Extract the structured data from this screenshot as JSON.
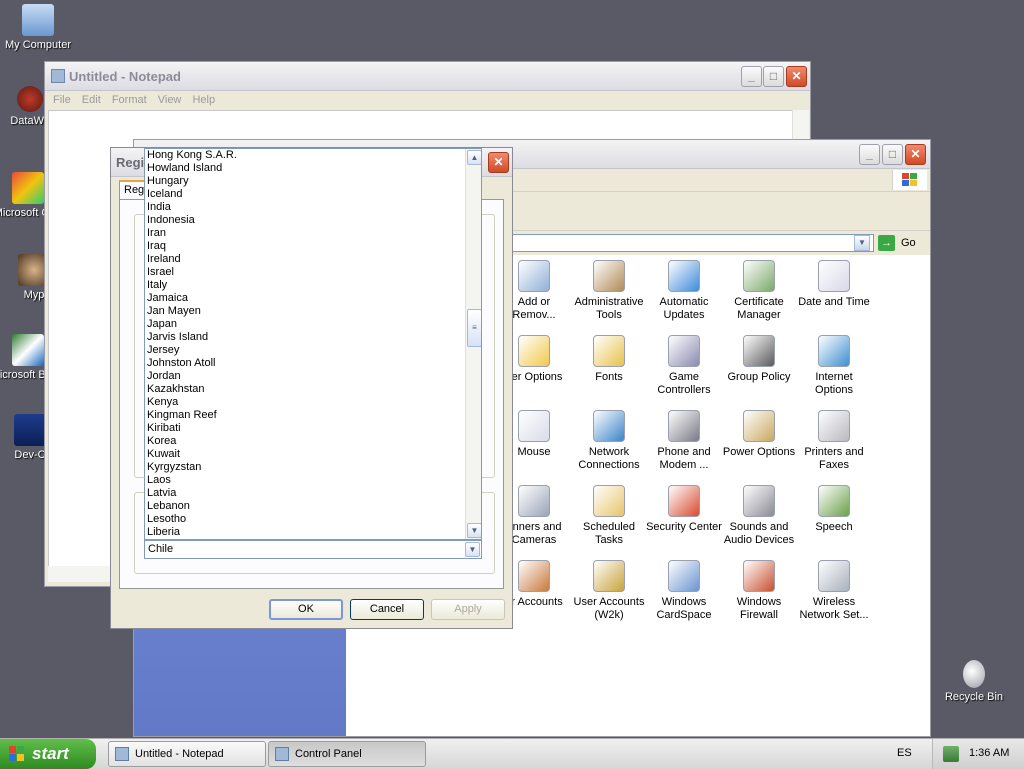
{
  "desktop": {
    "icons": [
      {
        "label": "My Computer"
      },
      {
        "label": "DataWa"
      },
      {
        "label": "Microsoft C++"
      },
      {
        "label": "Myp"
      },
      {
        "label": "Microsoft Basic"
      },
      {
        "label": "Dev-C"
      },
      {
        "label": "Recycle Bin"
      }
    ]
  },
  "notepad": {
    "title": "Untitled - Notepad",
    "menu": [
      "File",
      "Edit",
      "Format",
      "View",
      "Help"
    ]
  },
  "control_panel": {
    "go_label": "Go",
    "items": [
      {
        "label": "Add or Remov...",
        "icon": "add-remove-icon"
      },
      {
        "label": "Administrative Tools",
        "icon": "admin-tools-icon"
      },
      {
        "label": "Automatic Updates",
        "icon": "windows-update-icon"
      },
      {
        "label": "Certificate Manager",
        "icon": "certificate-icon"
      },
      {
        "label": "Date and Time",
        "icon": "clock-icon"
      },
      {
        "label": "der Options",
        "icon": "folder-options-icon"
      },
      {
        "label": "Fonts",
        "icon": "fonts-icon"
      },
      {
        "label": "Game Controllers",
        "icon": "gamepad-icon"
      },
      {
        "label": "Group Policy",
        "icon": "group-policy-icon"
      },
      {
        "label": "Internet Options",
        "icon": "globe-icon"
      },
      {
        "label": "Mouse",
        "icon": "mouse-icon"
      },
      {
        "label": "Network Connections",
        "icon": "network-icon"
      },
      {
        "label": "Phone and Modem ...",
        "icon": "phone-icon"
      },
      {
        "label": "Power Options",
        "icon": "power-icon"
      },
      {
        "label": "Printers and Faxes",
        "icon": "printer-icon"
      },
      {
        "label": "anners and Cameras",
        "icon": "scanner-icon"
      },
      {
        "label": "Scheduled Tasks",
        "icon": "scheduled-tasks-icon"
      },
      {
        "label": "Security Center",
        "icon": "shield-icon"
      },
      {
        "label": "Sounds and Audio Devices",
        "icon": "speaker-icon"
      },
      {
        "label": "Speech",
        "icon": "speech-icon"
      },
      {
        "label": "er Accounts",
        "icon": "users-icon"
      },
      {
        "label": "User Accounts (W2k)",
        "icon": "user-key-icon"
      },
      {
        "label": "Windows CardSpace",
        "icon": "cardspace-icon"
      },
      {
        "label": "Windows Firewall",
        "icon": "firewall-icon"
      },
      {
        "label": "Wireless Network Set...",
        "icon": "wireless-icon"
      }
    ]
  },
  "regional_dialog": {
    "title": "Regi",
    "tab_partial": "Reg",
    "country_list": [
      "Hong Kong S.A.R.",
      "Howland Island",
      "Hungary",
      "Iceland",
      "India",
      "Indonesia",
      "Iran",
      "Iraq",
      "Ireland",
      "Israel",
      "Italy",
      "Jamaica",
      "Jan Mayen",
      "Japan",
      "Jarvis Island",
      "Jersey",
      "Johnston Atoll",
      "Jordan",
      "Kazakhstan",
      "Kenya",
      "Kingman Reef",
      "Kiribati",
      "Korea",
      "Kuwait",
      "Kyrgyzstan",
      "Laos",
      "Latvia",
      "Lebanon",
      "Lesotho",
      "Liberia"
    ],
    "selected_value": "Chile",
    "ok_label": "OK",
    "cancel_label": "Cancel",
    "apply_label": "Apply"
  },
  "taskbar": {
    "start_label": "start",
    "tasks": [
      {
        "label": "Untitled - Notepad"
      },
      {
        "label": "Control Panel"
      }
    ],
    "language": "ES",
    "clock": "1:36 AM"
  }
}
